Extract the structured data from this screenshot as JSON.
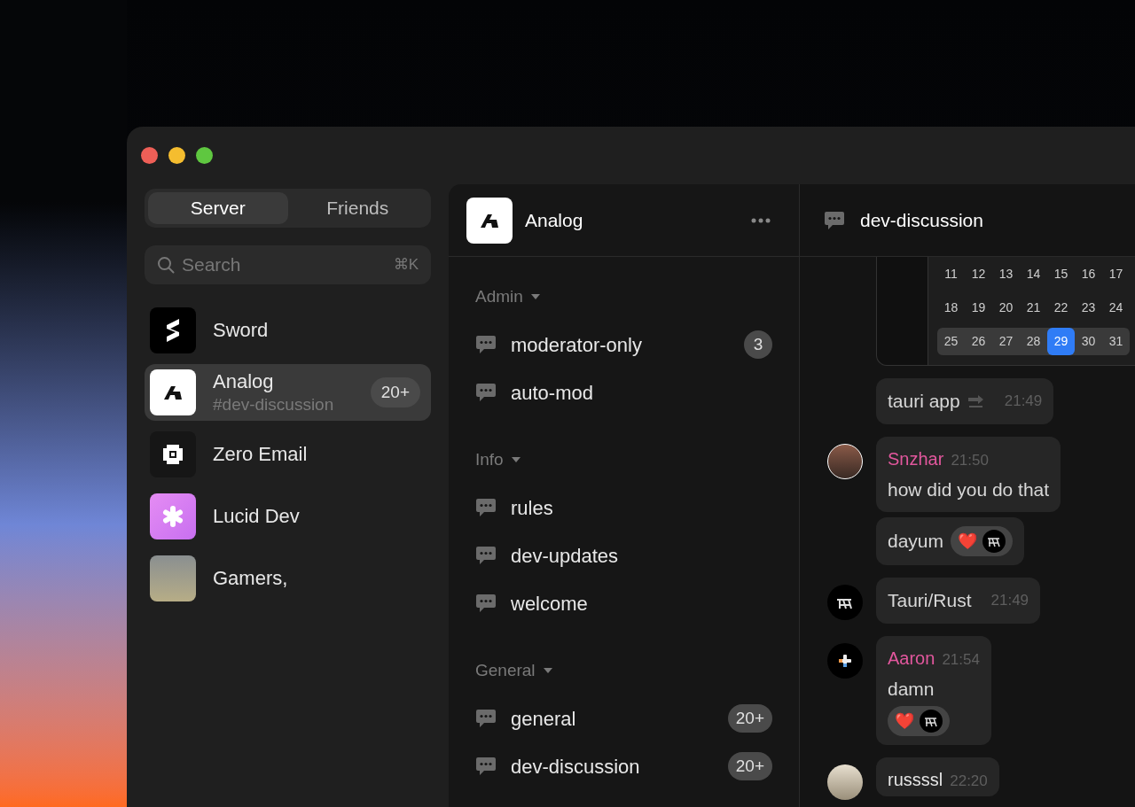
{
  "tabs": [
    {
      "label": "Server",
      "selected": true
    },
    {
      "label": "Friends",
      "selected": false
    }
  ],
  "search": {
    "placeholder": "Search",
    "shortcut": "⌘K"
  },
  "servers": [
    {
      "name": "Sword",
      "kind": "sword",
      "selected": false
    },
    {
      "name": "Analog",
      "subtitle": "#dev-discussion",
      "badge": "20+",
      "kind": "analog",
      "selected": true
    },
    {
      "name": "Zero Email",
      "kind": "zero",
      "selected": false
    },
    {
      "name": "Lucid Dev",
      "kind": "lucid",
      "selected": false
    },
    {
      "name": "Gamers,",
      "kind": "photo",
      "selected": false
    }
  ],
  "server_header": {
    "name": "Analog"
  },
  "sections": [
    {
      "title": "Admin",
      "expanded": true,
      "channels": [
        {
          "name": "moderator-only",
          "badge": "3"
        },
        {
          "name": "auto-mod"
        }
      ]
    },
    {
      "title": "Info",
      "expanded": true,
      "channels": [
        {
          "name": "rules"
        },
        {
          "name": "dev-updates"
        },
        {
          "name": "welcome"
        }
      ]
    },
    {
      "title": "General",
      "expanded": true,
      "channels": [
        {
          "name": "general",
          "badge": "20+"
        },
        {
          "name": "dev-discussion",
          "badge": "20+"
        }
      ]
    }
  ],
  "chat": {
    "channel": "dev-discussion",
    "calendar": {
      "weeks": [
        {
          "highlighted": false,
          "days": [
            {
              "day": "11",
              "selected": false
            },
            {
              "day": "12",
              "selected": false
            },
            {
              "day": "13",
              "selected": false
            },
            {
              "day": "14",
              "selected": false
            },
            {
              "day": "15",
              "selected": false
            },
            {
              "day": "16",
              "selected": false
            },
            {
              "day": "17",
              "selected": false
            }
          ]
        },
        {
          "highlighted": false,
          "days": [
            {
              "day": "18",
              "selected": false
            },
            {
              "day": "19",
              "selected": false
            },
            {
              "day": "20",
              "selected": false
            },
            {
              "day": "21",
              "selected": false
            },
            {
              "day": "22",
              "selected": false
            },
            {
              "day": "23",
              "selected": false
            },
            {
              "day": "24",
              "selected": false
            }
          ]
        },
        {
          "highlighted": true,
          "days": [
            {
              "day": "25",
              "selected": false
            },
            {
              "day": "26",
              "selected": false
            },
            {
              "day": "27",
              "selected": false
            },
            {
              "day": "28",
              "selected": false
            },
            {
              "day": "29",
              "selected": true
            },
            {
              "day": "30",
              "selected": false
            },
            {
              "day": "31",
              "selected": false
            }
          ]
        }
      ]
    },
    "groups": [
      {
        "kind": "continuation",
        "messages": [
          {
            "text": "tauri app",
            "time": "21:49",
            "soon": true
          }
        ]
      },
      {
        "kind": "person",
        "author": "Snzhar",
        "time": "21:50",
        "messages": [
          {
            "text": "how did you do that"
          },
          {
            "text": "dayum",
            "reactions": [
              "❤️"
            ]
          }
        ]
      },
      {
        "kind": "bot",
        "messages": [
          {
            "text": "Tauri/Rust",
            "time": "21:49"
          }
        ]
      },
      {
        "kind": "plus",
        "author": "Aaron",
        "time": "21:54",
        "messages": [
          {
            "text": "damn",
            "reactions_below": [
              "❤️"
            ]
          }
        ]
      },
      {
        "kind": "hamster",
        "author": "russssl",
        "time": "22:20"
      }
    ]
  }
}
